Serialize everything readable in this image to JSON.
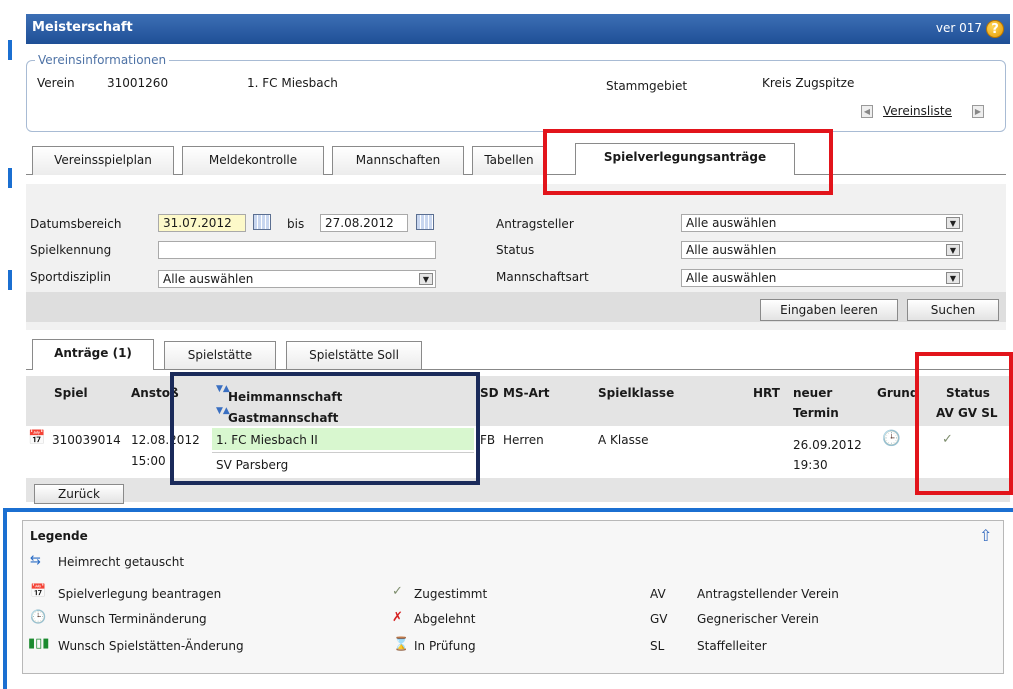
{
  "window": {
    "title": "Meisterschaft",
    "version": "ver 017"
  },
  "club_info": {
    "section_label": "Vereinsinformationen",
    "verein_label": "Verein",
    "verein_id": "31001260",
    "verein_name": "1. FC Miesbach",
    "stammgebiet_label": "Stammgebiet",
    "stammgebiet_value": "Kreis Zugspitze",
    "vereinsliste_link": "Vereinsliste"
  },
  "tabs": [
    "Vereinsspielplan",
    "Meldekontrolle",
    "Mannschaften",
    "Tabellen",
    "Spielverlegungsanträge"
  ],
  "filters": {
    "datumsbereich_label": "Datumsbereich",
    "date_from": "31.07.2012",
    "bis_label": "bis",
    "date_to": "27.08.2012",
    "spielkennung_label": "Spielkennung",
    "spielkennung_value": "",
    "sportdisziplin_label": "Sportdisziplin",
    "sportdisziplin_value": "Alle auswählen",
    "antragsteller_label": "Antragsteller",
    "antragsteller_value": "Alle auswählen",
    "status_label": "Status",
    "status_value": "Alle auswählen",
    "mannschaftsart_label": "Mannschaftsart",
    "mannschaftsart_value": "Alle auswählen",
    "clear_button": "Eingaben leeren",
    "search_button": "Suchen"
  },
  "subtabs": [
    "Anträge (1)",
    "Spielstätte",
    "Spielstätte Soll"
  ],
  "table": {
    "headers": {
      "spiel": "Spiel",
      "anstoss": "Anstoß",
      "heim": "Heimmannschaft",
      "gast": "Gastmannschaft",
      "sd": "SD",
      "msart": "MS-Art",
      "spielklasse": "Spielklasse",
      "hrt": "HRT",
      "neuer": "neuer",
      "termin": "Termin",
      "grund": "Grund",
      "status": "Status",
      "status_sub": "AV GV SL"
    },
    "row": {
      "spiel": "310039014",
      "date": "12.08.2012",
      "time": "15:00",
      "heim": "1. FC Miesbach II",
      "gast": "SV Parsberg",
      "sd": "FB",
      "msart": "Herren",
      "spielklasse": "A Klasse",
      "hrt": "",
      "new_date": "26.09.2012",
      "new_time": "19:30"
    },
    "back_button": "Zurück"
  },
  "legend": {
    "title": "Legende",
    "col1": [
      "Heimrecht getauscht",
      "Spielverlegung beantragen",
      "Wunsch Terminänderung",
      "Wunsch Spielstätten-Änderung"
    ],
    "col2": [
      "Zugestimmt",
      "Abgelehnt",
      "In Prüfung"
    ],
    "col3_abbr": [
      "AV",
      "GV",
      "SL"
    ],
    "col3_text": [
      "Antragstellender Verein",
      "Gegnerischer Verein",
      "Staffelleiter"
    ]
  }
}
